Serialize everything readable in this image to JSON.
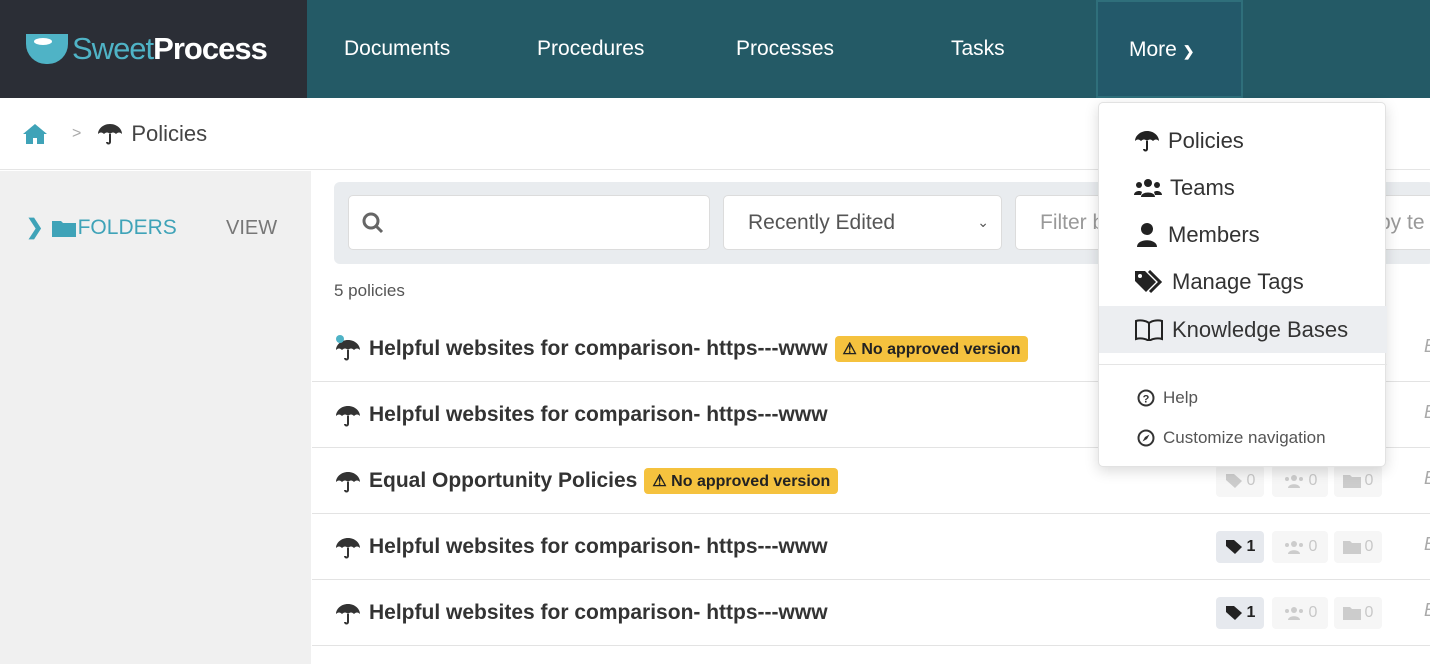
{
  "brand": {
    "sweet": "Sweet",
    "process": "Process"
  },
  "nav": {
    "items": [
      "Documents",
      "Procedures",
      "Processes",
      "Tasks"
    ],
    "more": "More"
  },
  "breadcrumb": {
    "current": "Policies"
  },
  "sidebar": {
    "folders": "FOLDERS",
    "view": "VIEW"
  },
  "filters": {
    "search_value": "",
    "sort": "Recently Edited",
    "filter1": "Filter b",
    "filter2": "by te"
  },
  "count_label": "5 policies",
  "warning_label": "No approved version",
  "policies": [
    {
      "title": "Helpful websites for comparison- https---www",
      "warning": true,
      "tags": null,
      "teams": null,
      "folders": null
    },
    {
      "title": "Helpful websites for comparison- https---www",
      "warning": false,
      "tags": null,
      "teams": null,
      "folders": null
    },
    {
      "title": "Equal Opportunity Policies",
      "warning": true,
      "tags": "0",
      "teams": "0",
      "folders": "0"
    },
    {
      "title": "Helpful websites for comparison- https---www",
      "warning": false,
      "tags": "1",
      "teams": "0",
      "folders": "0"
    },
    {
      "title": "Helpful websites for comparison- https---www",
      "warning": false,
      "tags": "1",
      "teams": "0",
      "folders": "0"
    }
  ],
  "edge_letter": "E",
  "menu": {
    "items": [
      {
        "label": "Policies",
        "icon": "umbrella-icon"
      },
      {
        "label": "Teams",
        "icon": "users-icon"
      },
      {
        "label": "Members",
        "icon": "user-icon"
      },
      {
        "label": "Manage Tags",
        "icon": "tags-icon"
      },
      {
        "label": "Knowledge Bases",
        "icon": "book-icon"
      }
    ],
    "help": "Help",
    "customize": "Customize navigation"
  },
  "colors": {
    "nav": "#245a66",
    "logo_bg": "#2b2e36",
    "accent": "#4fb3c6",
    "warning": "#f5c23e"
  }
}
